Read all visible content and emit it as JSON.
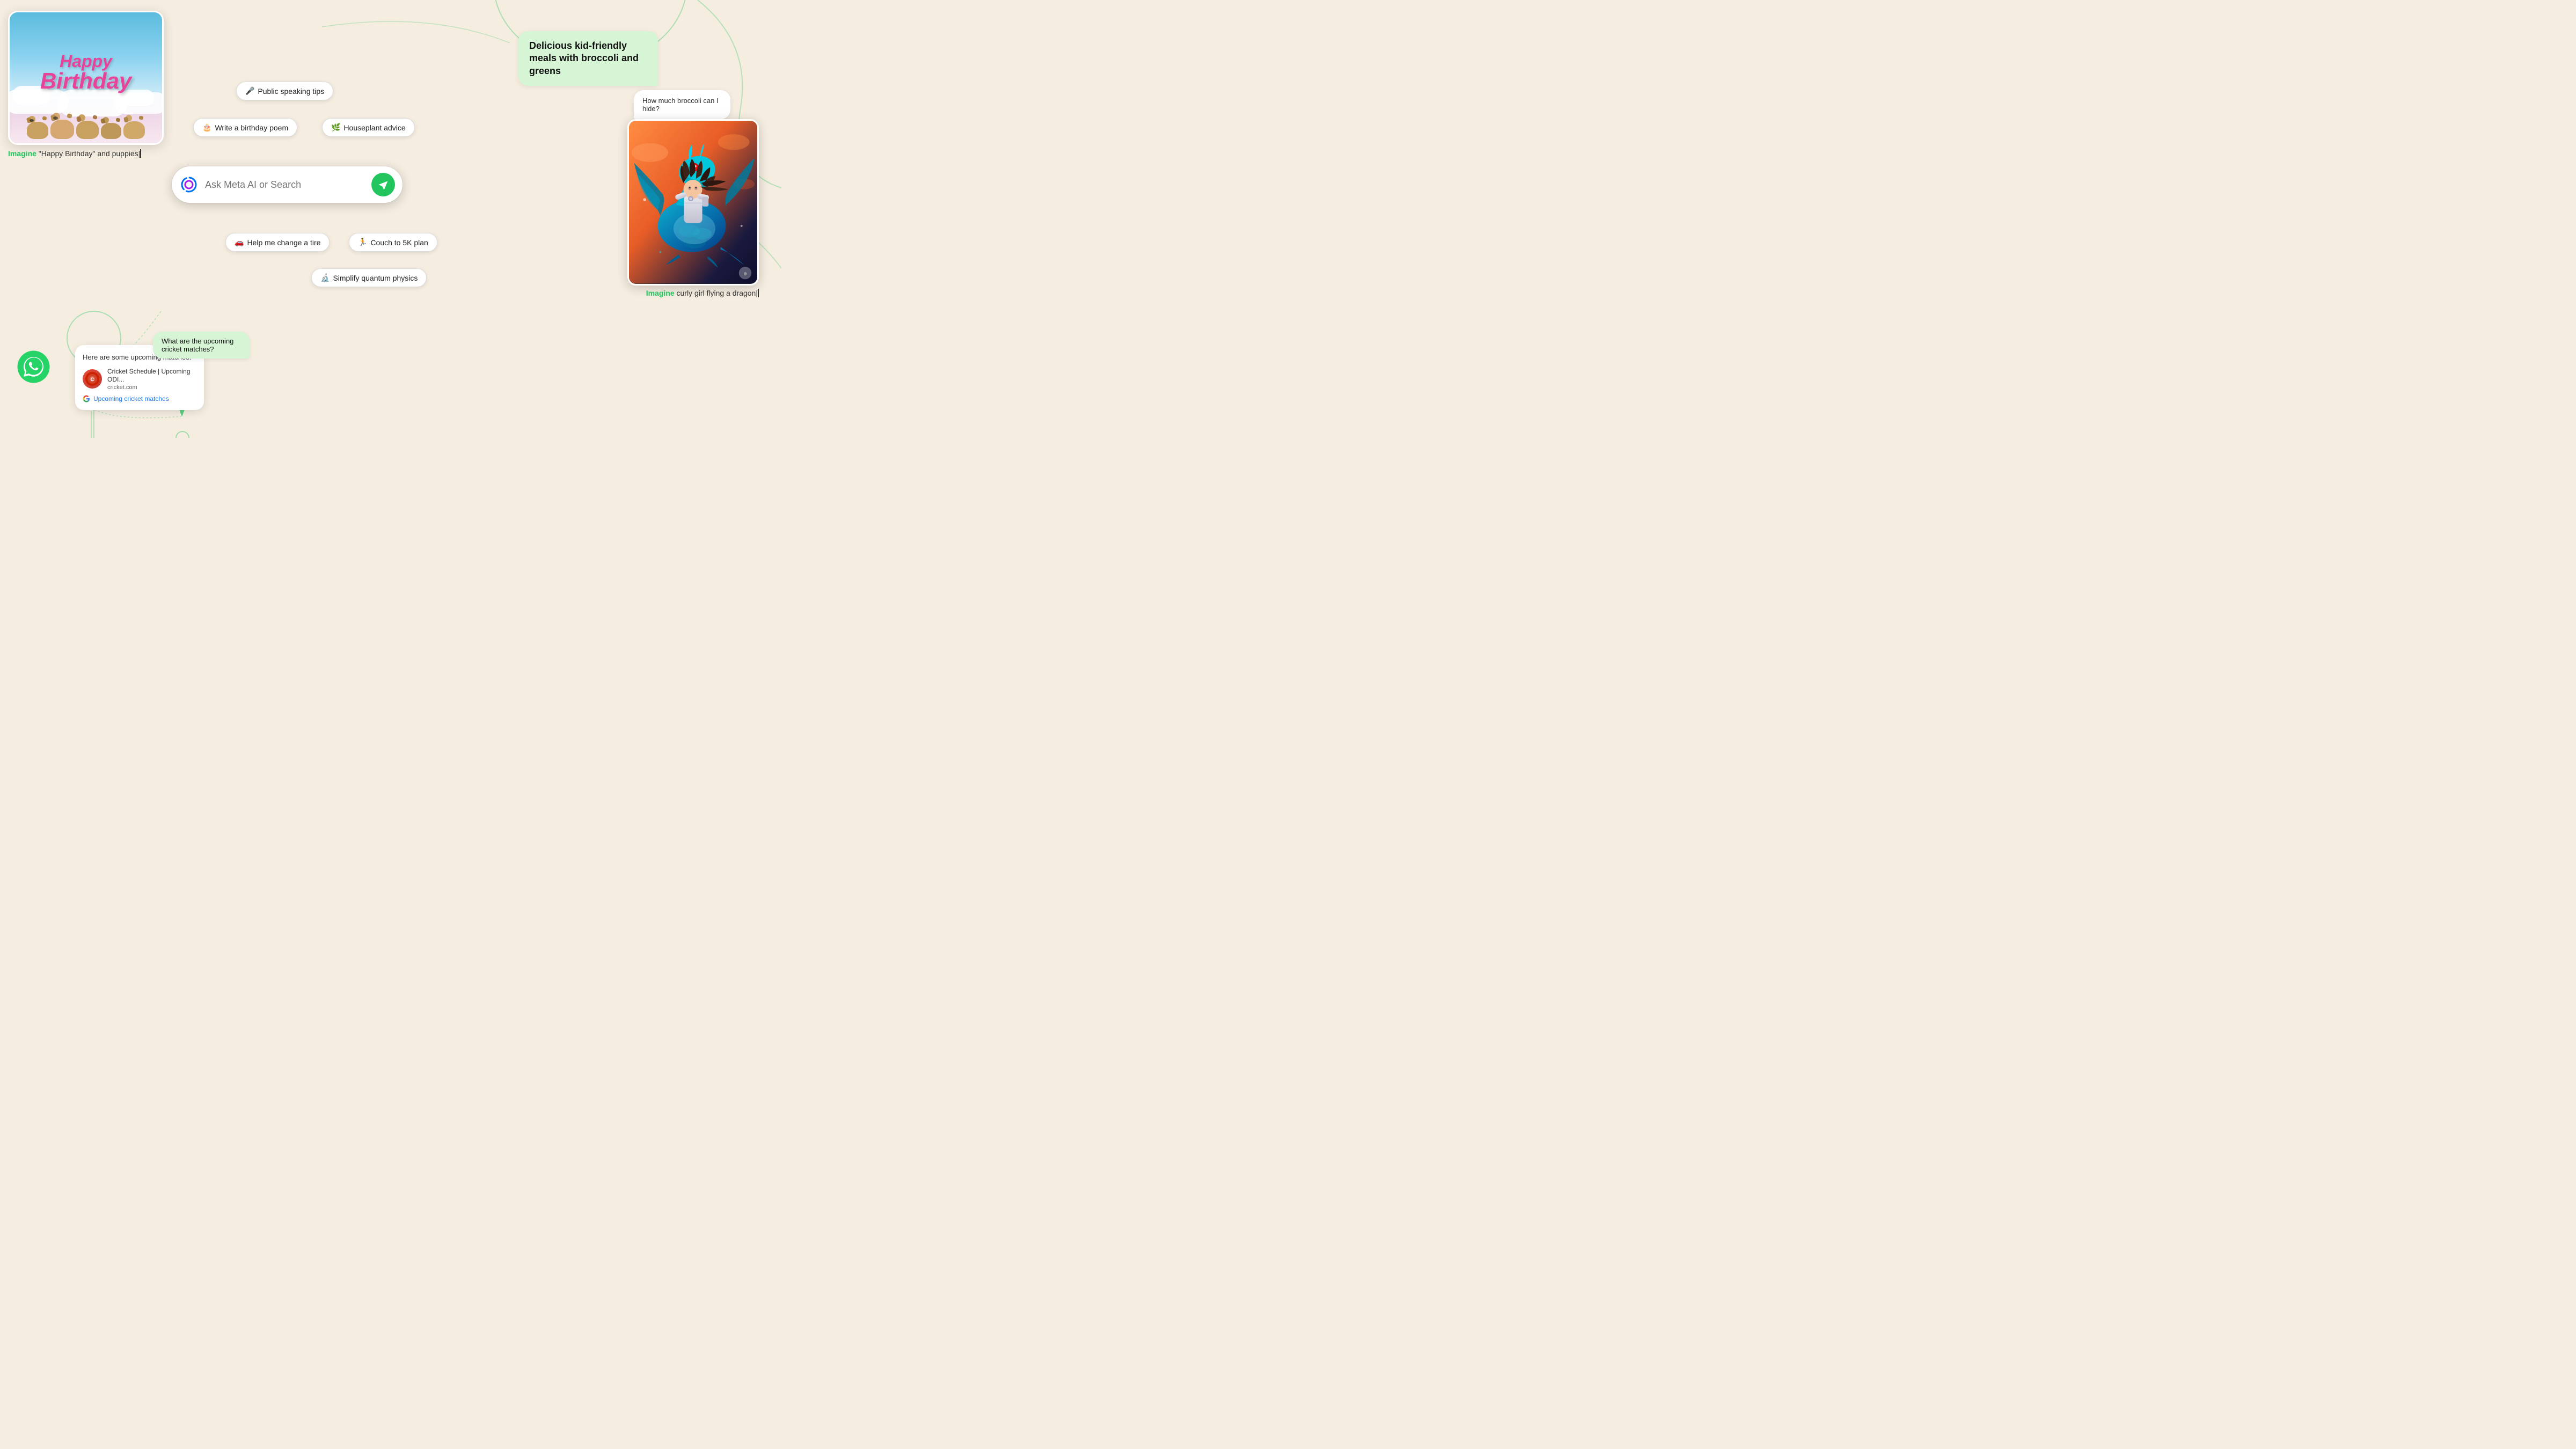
{
  "background_color": "#f5ede0",
  "accent_color": "#22c55e",
  "birthday_card": {
    "happy_text": "Happy",
    "birthday_text": "Birthday",
    "imagine_label": "Imagine",
    "imagine_prompt": " \"Happy Birthday\" and puppies"
  },
  "search_bar": {
    "placeholder": "Ask Meta AI or Search"
  },
  "pills": [
    {
      "id": "public-speaking",
      "icon": "🎤",
      "label": "Public speaking tips"
    },
    {
      "id": "birthday-poem",
      "icon": "🎂",
      "label": "Write a birthday poem"
    },
    {
      "id": "houseplant",
      "icon": "🌿",
      "label": "Houseplant advice"
    },
    {
      "id": "change-tire",
      "icon": "🚗",
      "label": "Help me change a tire"
    },
    {
      "id": "couch-5k",
      "icon": "🏃",
      "label": "Couch to 5K plan"
    },
    {
      "id": "quantum",
      "icon": "🔬",
      "label": "Simplify quantum physics"
    }
  ],
  "chat_bubble_main": {
    "text": "Delicious kid-friendly meals with broccoli and greens"
  },
  "chat_bubble_small": {
    "text": "How much broccoli can I hide?"
  },
  "dragon_card": {
    "imagine_label": "Imagine",
    "imagine_prompt": " curly girl flying a dragon"
  },
  "cricket": {
    "header": "Here are some upcoming matches:",
    "result_title": "Cricket Schedule | Upcoming ODI...",
    "result_domain": "cricket.com",
    "google_link": "Upcoming cricket matches",
    "query_text": "What are the upcoming cricket matches?"
  },
  "whatsapp": {
    "label": "WhatsApp logo"
  }
}
